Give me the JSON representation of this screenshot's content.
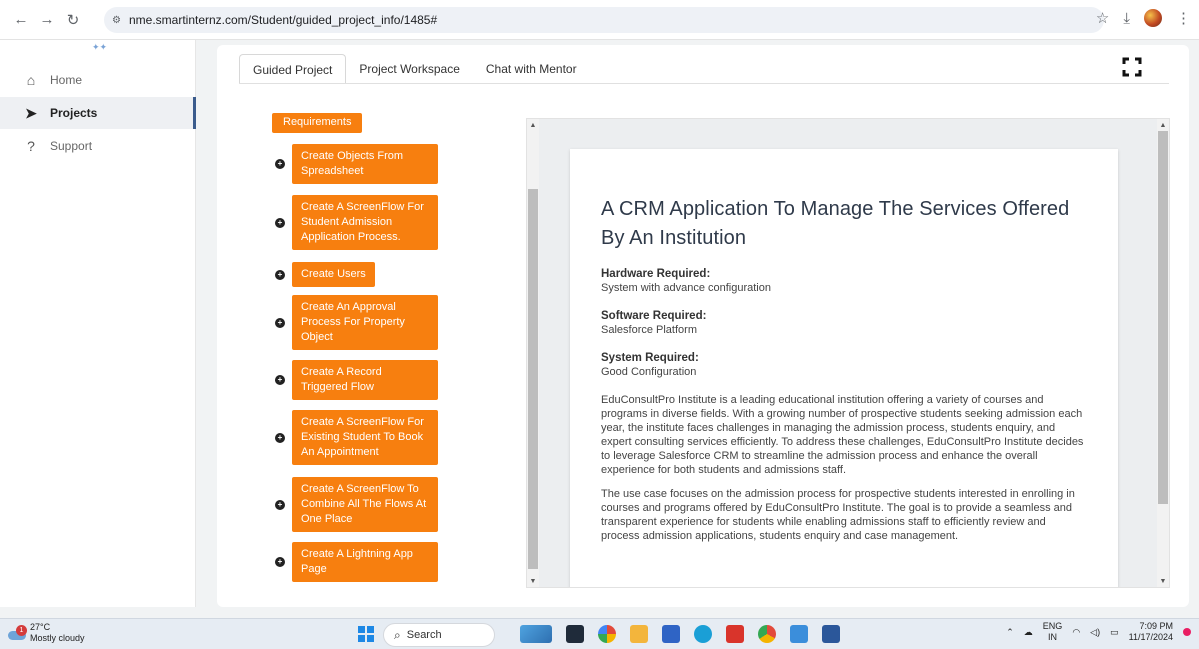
{
  "browser": {
    "url": "nme.smartinternz.com/Student/guided_project_info/1485#"
  },
  "sidebar": {
    "items": [
      {
        "label": "Home",
        "icon": "home-icon"
      },
      {
        "label": "Projects",
        "icon": "paper-plane-icon"
      },
      {
        "label": "Support",
        "icon": "question-icon"
      }
    ]
  },
  "tabs": [
    {
      "label": "Guided Project",
      "active": true
    },
    {
      "label": "Project Workspace",
      "active": false
    },
    {
      "label": "Chat with Mentor",
      "active": false
    }
  ],
  "steps": {
    "partial_first": "Requirements",
    "items": [
      "Create Objects From Spreadsheet",
      "Create A ScreenFlow For Student Admission Application Process.",
      "Create Users",
      "Create An Approval Process For Property Object",
      "Create A Record Triggered Flow",
      "Create A ScreenFlow For Existing Student To Book An Appointment",
      "Create A ScreenFlow To Combine All The Flows At One Place",
      "Create A Lightning App Page"
    ]
  },
  "document": {
    "title": "A CRM Application To Manage The Services Offered By An Institution",
    "hardware_label": "Hardware Required:",
    "hardware_value": "System with advance configuration",
    "software_label": "Software Required:",
    "software_value": "Salesforce Platform",
    "system_label": "System Required:",
    "system_value": "Good Configuration",
    "paragraph1": "EduConsultPro Institute is a leading educational institution offering a variety of courses and programs in diverse fields. With a growing number of prospective students seeking admission each year, the institute faces challenges in managing the admission process, students enquiry, and expert consulting services efficiently. To address these challenges, EduConsultPro Institute decides to leverage Salesforce CRM to streamline the admission process and enhance the overall experience for both students and admissions staff.",
    "paragraph2": "The use case focuses on the admission process for prospective students interested in enrolling in courses and programs offered by EduConsultPro Institute. The goal is to provide a seamless and transparent experience for students while enabling admissions staff to efficiently review and process admission applications, students enquiry and case management."
  },
  "taskbar": {
    "weather_temp": "27°C",
    "weather_desc": "Mostly cloudy",
    "weather_badge": "1",
    "search_label": "Search",
    "lang_line1": "ENG",
    "lang_line2": "IN",
    "time": "7:09 PM",
    "date": "11/17/2024"
  },
  "colors": {
    "step_orange": "#f77f0f",
    "title_text": "#2f3a4a"
  }
}
